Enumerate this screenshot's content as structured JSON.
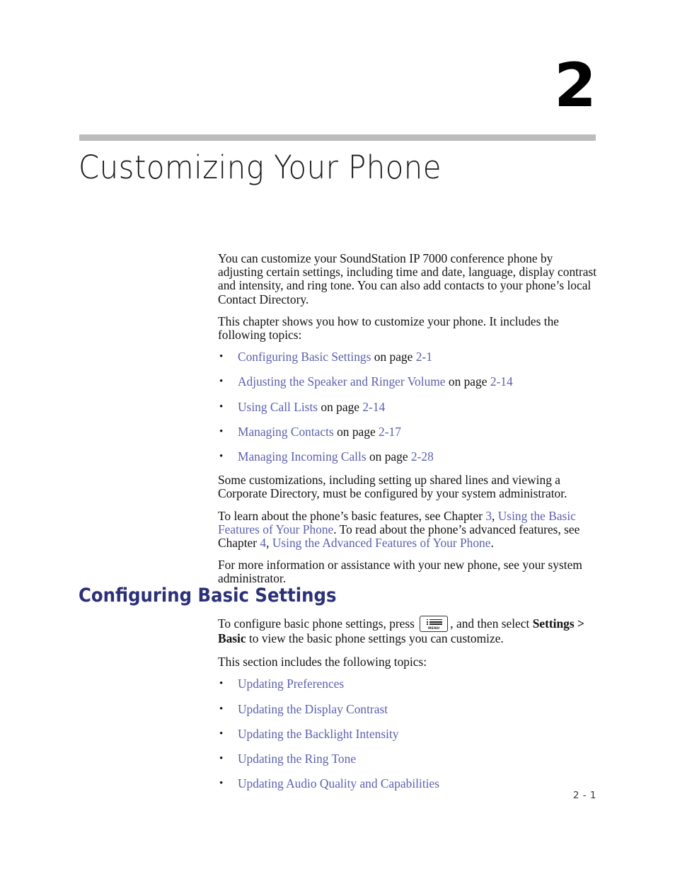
{
  "chapter": {
    "number": "2",
    "title": "Customizing Your Phone"
  },
  "intro": {
    "paragraph_1": "You can customize your SoundStation IP 7000 conference phone by adjusting certain settings, including time and date, language, display contrast and intensity, and ring tone. You can also add contacts to your phone’s local Contact Directory.",
    "paragraph_2": "This chapter shows you how to customize your phone. It includes the following topics:"
  },
  "topics": {
    "bullet_glyph": "•",
    "on_page_label": "on page",
    "items": [
      {
        "link": "Configuring Basic Settings",
        "page": "2-1"
      },
      {
        "link": "Adjusting the Speaker and Ringer Volume",
        "page": "2-14"
      },
      {
        "link": "Using Call Lists",
        "page": "2-14"
      },
      {
        "link": "Managing Contacts",
        "page": "2-17"
      },
      {
        "link": "Managing Incoming Calls",
        "page": "2-28"
      }
    ]
  },
  "notes": {
    "customizations": "Some customizations, including setting up shared lines and viewing a Corporate Directory, must be configured by your system administrator.",
    "cross_ref": {
      "lead_1": "To learn about the phone’s basic features, see Chapter ",
      "chapter_3": "3",
      "comma_1": ", ",
      "chapter_3_title": "Using the Basic Features of Your Phone",
      "middle": ". To read about the phone’s advanced features, see Chapter ",
      "chapter_4": "4",
      "comma_2": ", ",
      "chapter_4_title": "Using the Advanced Features of Your Phone",
      "period": "."
    },
    "more_info": "For more information or assistance with your new phone, see your system administrator."
  },
  "section": {
    "heading": "Configuring Basic Settings",
    "instruction_prefix": "To configure basic phone settings, press",
    "instruction_middle": ", and then select",
    "settings_path": "Settings > Basic",
    "instruction_suffix": " to view the basic phone settings you can customize.",
    "topics_intro": "This section includes the following topics:",
    "menu_key": {
      "icon": "menu-list-icon",
      "label": "MENU"
    },
    "topics": [
      "Updating Preferences",
      "Updating the Display Contrast",
      "Updating the Backlight Intensity",
      "Updating the Ring Tone",
      "Updating Audio Quality and Capabilities"
    ]
  },
  "footer": {
    "page_number": "2 - 1"
  },
  "colors": {
    "link": "#5b60ad",
    "heading": "#2c3079",
    "rule": "#bcbcbc"
  }
}
